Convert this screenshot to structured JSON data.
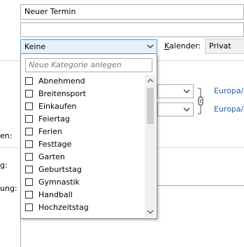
{
  "appointment": {
    "subject": "Neuer Termin",
    "location": ""
  },
  "category": {
    "selected": "Keine",
    "new_placeholder": "Neue Kategorie anlegen",
    "items": [
      "Abnehmend",
      "Breitensport",
      "Einkaufen",
      "Feiertag",
      "Ferien",
      "Festtage",
      "Garten",
      "Geburtstag",
      "Gymnastik",
      "Handball",
      "Hochzeitstag"
    ]
  },
  "calendar": {
    "label_prefix": "",
    "label_accel": "K",
    "label_rest": "alender:",
    "value": "Privat"
  },
  "timezone": {
    "start_link": "Europa/",
    "end_link": "Europa/"
  },
  "side_labels": {
    "a": "en:",
    "b": "g:",
    "c": "ung:"
  },
  "icons": {
    "dropdown": "chevron-down-icon",
    "timezone": "timezone-link-icon"
  }
}
